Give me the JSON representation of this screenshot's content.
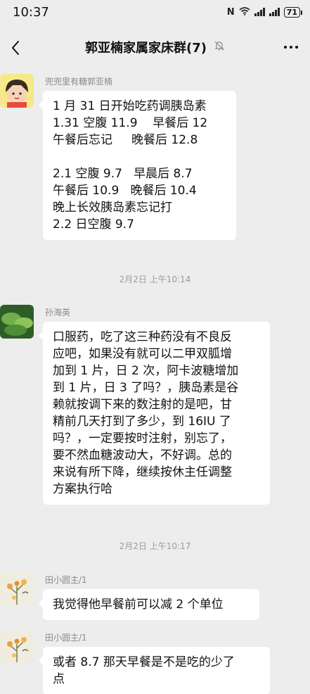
{
  "status_bar": {
    "time": "10:37",
    "battery": "71"
  },
  "header": {
    "title": "郭亚楠家属家床群(7)"
  },
  "messages": [
    {
      "sender": "兜兜里有糖郭亚楠",
      "lines": [
        "1 月 31 日开始吃药调胰岛素",
        "1.31 空腹 11.9    早餐后 12",
        "午餐后忘记     晚餐后 12.8",
        "",
        "2.1 空腹 9.7   早晨后 8.7",
        "午餐后 10.9   晚餐后 10.4",
        "晚上长效胰岛素忘记打",
        "2.2 日空腹 9.7"
      ]
    },
    {
      "sender": "孙海英",
      "lines": [
        "口服药，吃了这三种药没有不良反",
        "应吧，如果没有就可以二甲双胍增",
        "加到 1 片，日 2 次，阿卡波糖增加",
        "到 1 片，日 3 了吗？，胰岛素是谷",
        "赖就按调下来的数注射的是吧，甘",
        "精前几天打到了多少，到 16IU 了",
        "吗？，一定要按时注射，别忘了，",
        "要不然血糖波动大，不好调。总的",
        "来说有所下降，继续按休主任调整",
        "方案执行哈"
      ]
    },
    {
      "sender": "田小圆主/1",
      "lines": [
        "我觉得他早餐前可以减 2 个单位"
      ]
    },
    {
      "sender": "田小圆主/1",
      "lines": [
        "或者 8.7 那天早餐是不是吃的少了",
        "点"
      ]
    }
  ],
  "timestamps": [
    "2月2日  上午10:14",
    "2月2日  上午10:17"
  ]
}
